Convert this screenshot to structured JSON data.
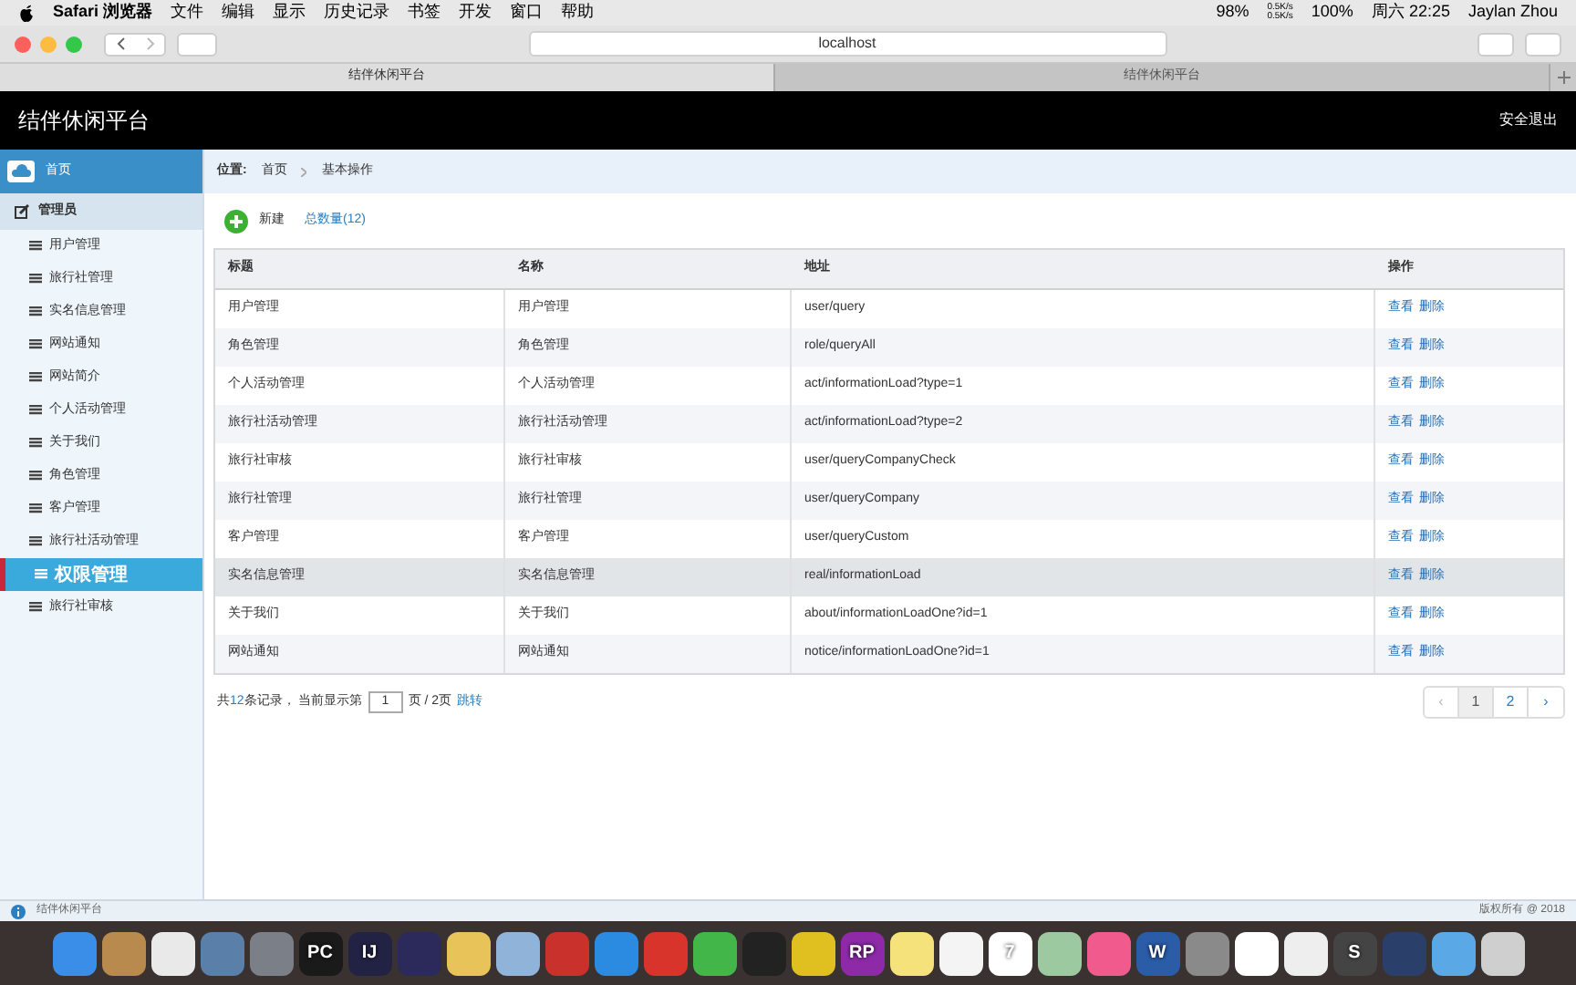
{
  "menu_bar": {
    "app": "Safari 浏览器",
    "menus": [
      "文件",
      "编辑",
      "显示",
      "历史记录",
      "书签",
      "开发",
      "窗口",
      "帮助"
    ],
    "battery_small": "98%",
    "net_up": "0.5K/s",
    "net_down": "0.5K/s",
    "battery": "100%",
    "clock": "周六 22:25",
    "user": "Jaylan Zhou"
  },
  "browser": {
    "address": "localhost",
    "tabs": [
      {
        "label": "结伴休闲平台",
        "selected": true
      },
      {
        "label": "结伴休闲平台",
        "selected": false
      }
    ]
  },
  "header": {
    "title": "结伴休闲平台",
    "logout": "安全退出"
  },
  "sidebar": {
    "home": "首页",
    "section": "管理员",
    "items": [
      {
        "label": "用户管理",
        "selected": false
      },
      {
        "label": "旅行社管理",
        "selected": false
      },
      {
        "label": "实名信息管理",
        "selected": false
      },
      {
        "label": "网站通知",
        "selected": false
      },
      {
        "label": "网站简介",
        "selected": false
      },
      {
        "label": "个人活动管理",
        "selected": false
      },
      {
        "label": "关于我们",
        "selected": false
      },
      {
        "label": "角色管理",
        "selected": false
      },
      {
        "label": "客户管理",
        "selected": false
      },
      {
        "label": "旅行社活动管理",
        "selected": false
      },
      {
        "label": "权限管理",
        "selected": true
      },
      {
        "label": "旅行社审核",
        "selected": false
      }
    ]
  },
  "breadcrumb": {
    "label": "位置:",
    "items": [
      "首页",
      "基本操作"
    ]
  },
  "toolbar": {
    "new": "新建",
    "count": "总数量(12)"
  },
  "table": {
    "columns": [
      "标题",
      "名称",
      "地址",
      "操作"
    ],
    "rows": [
      {
        "title": "用户管理",
        "name": "用户管理",
        "address": "user/query",
        "hovered": false,
        "actions": [
          "查看",
          "删除"
        ]
      },
      {
        "title": "角色管理",
        "name": "角色管理",
        "address": "role/queryAll",
        "hovered": false,
        "actions": [
          "查看",
          "删除"
        ]
      },
      {
        "title": "个人活动管理",
        "name": "个人活动管理",
        "address": "act/informationLoad?type=1",
        "hovered": false,
        "actions": [
          "查看",
          "删除"
        ]
      },
      {
        "title": "旅行社活动管理",
        "name": "旅行社活动管理",
        "address": "act/informationLoad?type=2",
        "hovered": false,
        "actions": [
          "查看",
          "删除"
        ]
      },
      {
        "title": "旅行社审核",
        "name": "旅行社审核",
        "address": "user/queryCompanyCheck",
        "hovered": false,
        "actions": [
          "查看",
          "删除"
        ]
      },
      {
        "title": "旅行社管理",
        "name": "旅行社管理",
        "address": "user/queryCompany",
        "hovered": false,
        "actions": [
          "查看",
          "删除"
        ]
      },
      {
        "title": "客户管理",
        "name": "客户管理",
        "address": "user/queryCustom",
        "hovered": false,
        "actions": [
          "查看",
          "删除"
        ]
      },
      {
        "title": "实名信息管理",
        "name": "实名信息管理",
        "address": "real/informationLoad",
        "hovered": true,
        "actions": [
          "查看",
          "删除"
        ]
      },
      {
        "title": "关于我们",
        "name": "关于我们",
        "address": "about/informationLoadOne?id=1",
        "hovered": false,
        "actions": [
          "查看",
          "删除"
        ]
      },
      {
        "title": "网站通知",
        "name": "网站通知",
        "address": "notice/informationLoadOne?id=1",
        "hovered": false,
        "actions": [
          "查看",
          "删除"
        ]
      }
    ]
  },
  "pagination": {
    "prefix": "共",
    "total": "12",
    "middle": "条记录， 当前显示第",
    "page": "1",
    "suffix": "页 / 2页",
    "jump": "跳转",
    "prev": "‹",
    "next": "›",
    "pages": [
      {
        "label": "1",
        "selected": true
      },
      {
        "label": "2",
        "selected": false
      }
    ]
  },
  "footer": {
    "left": "结伴休闲平台",
    "right": "版权所有 @ 2018"
  },
  "dock": [
    {
      "color": "#3b8ee8"
    },
    {
      "color": "#b98a4e"
    },
    {
      "color": "#e9e9e9"
    },
    {
      "color": "#5a7fa8"
    },
    {
      "color": "#7a7f88"
    },
    {
      "color": "#1a1a1a",
      "label": "PC"
    },
    {
      "color": "#222244",
      "label": "IJ"
    },
    {
      "color": "#2c2a5a"
    },
    {
      "color": "#e8c35a"
    },
    {
      "color": "#8fb3d9"
    },
    {
      "color": "#c8312c"
    },
    {
      "color": "#2b8be0"
    },
    {
      "color": "#d9342b"
    },
    {
      "color": "#42b649"
    },
    {
      "color": "#222222"
    },
    {
      "color": "#e0c020"
    },
    {
      "color": "#8e2aa8",
      "label": "RP"
    },
    {
      "color": "#f5e27a"
    },
    {
      "color": "#f4f4f4"
    },
    {
      "color": "#ffffff",
      "label": "7"
    },
    {
      "color": "#9cc9a0"
    },
    {
      "color": "#f05a8c"
    },
    {
      "color": "#2b5ca8",
      "label": "W"
    },
    {
      "color": "#8a8a8a"
    },
    {
      "color": "#ffffff"
    },
    {
      "color": "#eeeeee"
    },
    {
      "color": "#444444",
      "label": "S"
    },
    {
      "color": "#2a3f6a"
    },
    {
      "color": "#5aa9e6"
    },
    {
      "color": "#cfcfcf"
    }
  ]
}
